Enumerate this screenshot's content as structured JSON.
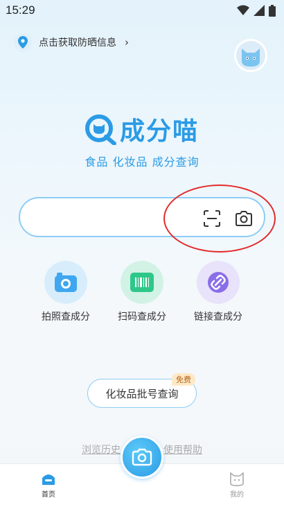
{
  "status_bar": {
    "time": "15:29"
  },
  "sun_banner": {
    "text": "点击获取防晒信息",
    "chevron": "›"
  },
  "logo": {
    "text": "成分喵",
    "tagline": "食品 化妆品 成分查询"
  },
  "search": {
    "placeholder": ""
  },
  "features": [
    {
      "label": "拍照查成分",
      "icon": "camera-icon",
      "color": "#cdeafb"
    },
    {
      "label": "扫码查成分",
      "icon": "barcode-icon",
      "color": "#c9f0e3"
    },
    {
      "label": "链接查成分",
      "icon": "link-icon",
      "color": "#e6dffa"
    }
  ],
  "batch_button": {
    "label": "化妆品批号查询",
    "badge": "免费"
  },
  "bottom_links": {
    "history": "浏览历史",
    "help": "使用帮助"
  },
  "tabs": {
    "home": "首页",
    "mine": "我的"
  },
  "colors": {
    "accent": "#2b9be6",
    "annotation": "#e22b2b"
  }
}
